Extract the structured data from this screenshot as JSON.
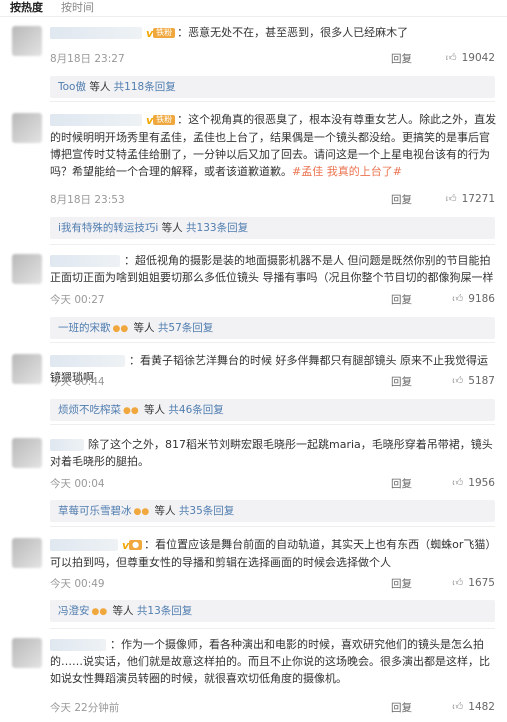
{
  "sort": {
    "hot": "按热度",
    "time": "按时间"
  },
  "icons": {
    "thumb": "thumbs-up-icon",
    "badge": "vip-badge",
    "v": "verified-v-icon"
  },
  "comments": [
    {
      "badge": "铁粉",
      "text": "：恶意无处不在，甚至恶到，很多人已经麻木了",
      "time": "8月18日 23:27",
      "reply": "回复",
      "likes": "19042",
      "sub": {
        "who": "Too傲",
        "mid": " 等人 ",
        "count": "共118条回复"
      }
    },
    {
      "badge": "铁粉",
      "text": "：这个视角真的很恶臭了，根本没有尊重女艺人。除此之外，直发的时候明明开场秀里有孟佳，孟佳也上台了，结果偶是一个镜头都没给。更搞笑的是事后官博把宣传时艾特孟佳给删了，一分钟以后又加了回去。请问这是一个上星电视台该有的行为吗？希望能给一个合理的解释，或者该道歉道歉。",
      "topic": "#孟佳 我真的上台了#",
      "time": "8月18日 23:53",
      "reply": "回复",
      "likes": "17271",
      "sub": {
        "who": "i我有特殊的转运技巧i",
        "mid": " 等人 ",
        "count": "共133条回复"
      }
    },
    {
      "text": "：超低视角的摄影是装的地面摄影机器不是人 但问题是既然你别的节目能拍正面切正面为啥到姐姐要切那么多低位镜头 导播有事吗（况且你整个节目切的都像狗屎一样",
      "time": "今天 00:27",
      "reply": "回复",
      "likes": "9186",
      "sub": {
        "who": "一班的宋歌",
        "mid": " 等人 ",
        "count": "共57条回复"
      }
    },
    {
      "text": "：看黄子韬徐艺洋舞台的时候 好多伴舞都只有腿部镜头 原来不止我觉得运镜猥琐啊",
      "time": "今天 00:44",
      "reply": "回复",
      "likes": "5187",
      "sub": {
        "who": "烦烦不吃榨菜",
        "mid": " 等人 ",
        "count": "共46条回复"
      }
    },
    {
      "text": "除了这个之外，817稻米节刘畊宏跟毛晓彤一起跳maria，毛晓彤穿着吊带裙，镜头对着毛晓彤的腿拍。",
      "time": "今天 00:04",
      "reply": "回复",
      "likes": "1956",
      "sub": {
        "who": "草莓可乐雪碧冰",
        "mid": " 等人 ",
        "count": "共35条回复"
      }
    },
    {
      "text": "：看位置应该是舞台前面的自动轨道，其实天上也有东西（蜘蛛or飞猫）可以拍到吗，但尊重女性的导播和剪辑在选择画面的时候会选择做个人",
      "time": "今天 00:49",
      "reply": "回复",
      "likes": "1675",
      "sub": {
        "who": "冯澄安",
        "mid": " 等人 ",
        "count": "共13条回复"
      }
    },
    {
      "text": "：作为一个摄像师，看各种演出和电影的时候，喜欢研究他们的镜头是怎么拍的……说实话，他们就是故意这样拍的。而且不止你说的这场晚会。很多演出都是这样，比如说女性舞蹈演员转圈的时候，就很喜欢切低角度的摄像机。",
      "time": "今天 22分钟前",
      "reply": "回复",
      "likes": "1482"
    }
  ]
}
